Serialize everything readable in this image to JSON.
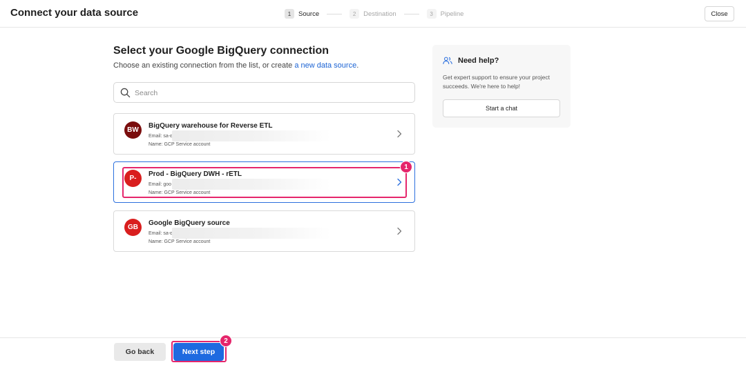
{
  "header": {
    "title": "Connect your data source",
    "steps": [
      {
        "number": "1",
        "label": "Source",
        "active": true
      },
      {
        "number": "2",
        "label": "Destination",
        "active": false
      },
      {
        "number": "3",
        "label": "Pipeline",
        "active": false
      }
    ],
    "close_label": "Close"
  },
  "main": {
    "heading": "Select your Google BigQuery connection",
    "subtext_prefix": "Choose an existing connection from the list, or create ",
    "subtext_link": "a new data source",
    "subtext_suffix": ".",
    "search_placeholder": "Search",
    "connections": [
      {
        "initials": "BW",
        "title": "BigQuery warehouse for Reverse ETL",
        "email": "Email: sa-ε",
        "name": "Name: GCP Service account",
        "avatar_color": "#7a0d0d",
        "selected": false
      },
      {
        "initials": "P-",
        "title": "Prod - BigQuery DWH - rETL",
        "email": "Email: goo",
        "name": "Name: GCP Service account",
        "avatar_color": "#d91e1e",
        "selected": true
      },
      {
        "initials": "GB",
        "title": "Google BigQuery source",
        "email": "Email: sa-ε",
        "name": "Name: GCP Service account",
        "avatar_color": "#d91e1e",
        "selected": false
      }
    ]
  },
  "help": {
    "title": "Need help?",
    "text": "Get expert support to ensure your project succeeds. We're here to help!",
    "button_label": "Start a chat"
  },
  "footer": {
    "back_label": "Go back",
    "next_label": "Next step"
  },
  "annotations": [
    "1",
    "2"
  ],
  "colors": {
    "accent": "#1e6ae0",
    "annotation": "#e5256b",
    "link": "#1b63d4"
  }
}
